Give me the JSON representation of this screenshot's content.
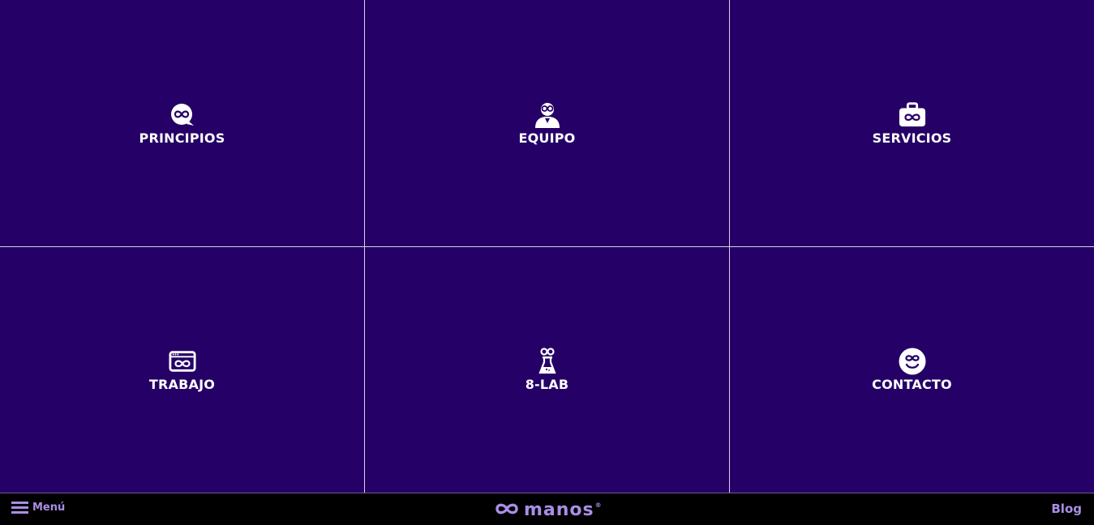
{
  "tiles": [
    {
      "label": "PRINCIPIOS",
      "icon": "chat-bubble-infinity-icon"
    },
    {
      "label": "EQUIPO",
      "icon": "person-glasses-icon"
    },
    {
      "label": "SERVICIOS",
      "icon": "briefcase-infinity-icon"
    },
    {
      "label": "TRABAJO",
      "icon": "browser-window-infinity-icon"
    },
    {
      "label": "8-LAB",
      "icon": "flask-icon"
    },
    {
      "label": "CONTACTO",
      "icon": "smiley-face-icon"
    }
  ],
  "footer": {
    "menu_label": "Menú",
    "logo_text": "manos",
    "logo_mark": "®",
    "blog_label": "Blog"
  },
  "colors": {
    "tile_background": "#250067",
    "grid_lines": "#d8d3e6",
    "footer_background": "#000000",
    "accent": "#a98ee6",
    "label_text": "#ffffff"
  }
}
